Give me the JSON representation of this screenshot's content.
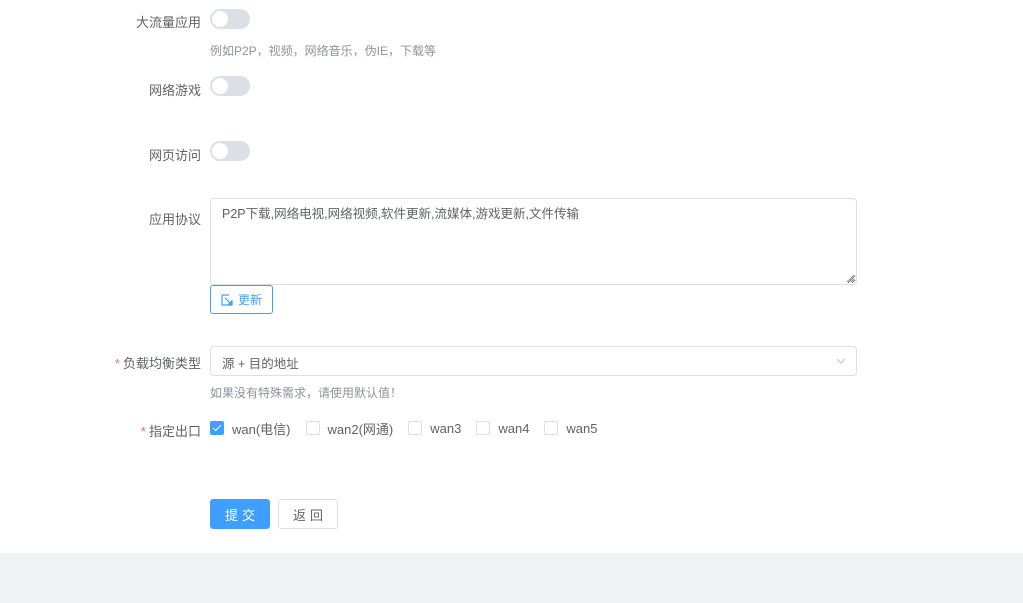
{
  "form": {
    "high_traffic": {
      "label": "大流量应用",
      "enabled": false,
      "hint": "例如P2P，视频，网络音乐，伪IE，下载等"
    },
    "online_game": {
      "label": "网络游戏",
      "enabled": false
    },
    "web_access": {
      "label": "网页访问",
      "enabled": false
    },
    "app_protocol": {
      "label": "应用协议",
      "value": "P2P下载,网络电视,网络视频,软件更新,流媒体,游戏更新,文件传输",
      "update_label": "更新"
    },
    "lb_type": {
      "required_mark": "*",
      "label": "负载均衡类型",
      "value": "源 + 目的地址",
      "hint": "如果没有特殊需求，请使用默认值！"
    },
    "exit": {
      "required_mark": "*",
      "label": "指定出口",
      "options": [
        {
          "label": "wan(电信)",
          "checked": true
        },
        {
          "label": "wan2(网通)",
          "checked": false
        },
        {
          "label": "wan3",
          "checked": false
        },
        {
          "label": "wan4",
          "checked": false
        },
        {
          "label": "wan5",
          "checked": false
        }
      ]
    },
    "submit_label": "提交",
    "back_label": "返回"
  },
  "colors": {
    "primary": "#409eff",
    "required": "#f56c6c",
    "switch_off": "#dcdfe6",
    "footer_bg": "#f0f2f5"
  },
  "icons": {
    "update": "edit-icon",
    "select_arrow": "chevron-down-icon",
    "checkbox_checked": "check-icon"
  }
}
